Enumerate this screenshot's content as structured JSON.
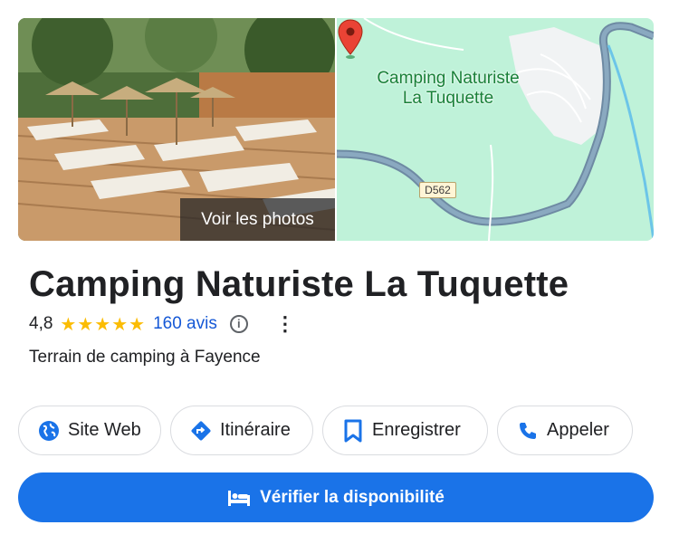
{
  "media": {
    "photo_button_label": "Voir les photos",
    "map_label": "Camping Naturiste\nLa Tuquette",
    "road_label": "D562"
  },
  "place": {
    "name": "Camping Naturiste La Tuquette",
    "rating": "4,8",
    "stars": "★★★★★",
    "star_rating": 4.8,
    "reviews_label": "160 avis",
    "category": "Terrain de camping à Fayence"
  },
  "actions": {
    "website": "Site Web",
    "directions": "Itinéraire",
    "save": "Enregistrer",
    "call": "Appeler"
  },
  "cta": {
    "label": "Vérifier la disponibilité"
  },
  "colors": {
    "accent": "#1a73e8",
    "star": "#fbbc04",
    "map_green": "#bff2d9",
    "river": "#5aa0c8",
    "pin": "#ea4335"
  }
}
